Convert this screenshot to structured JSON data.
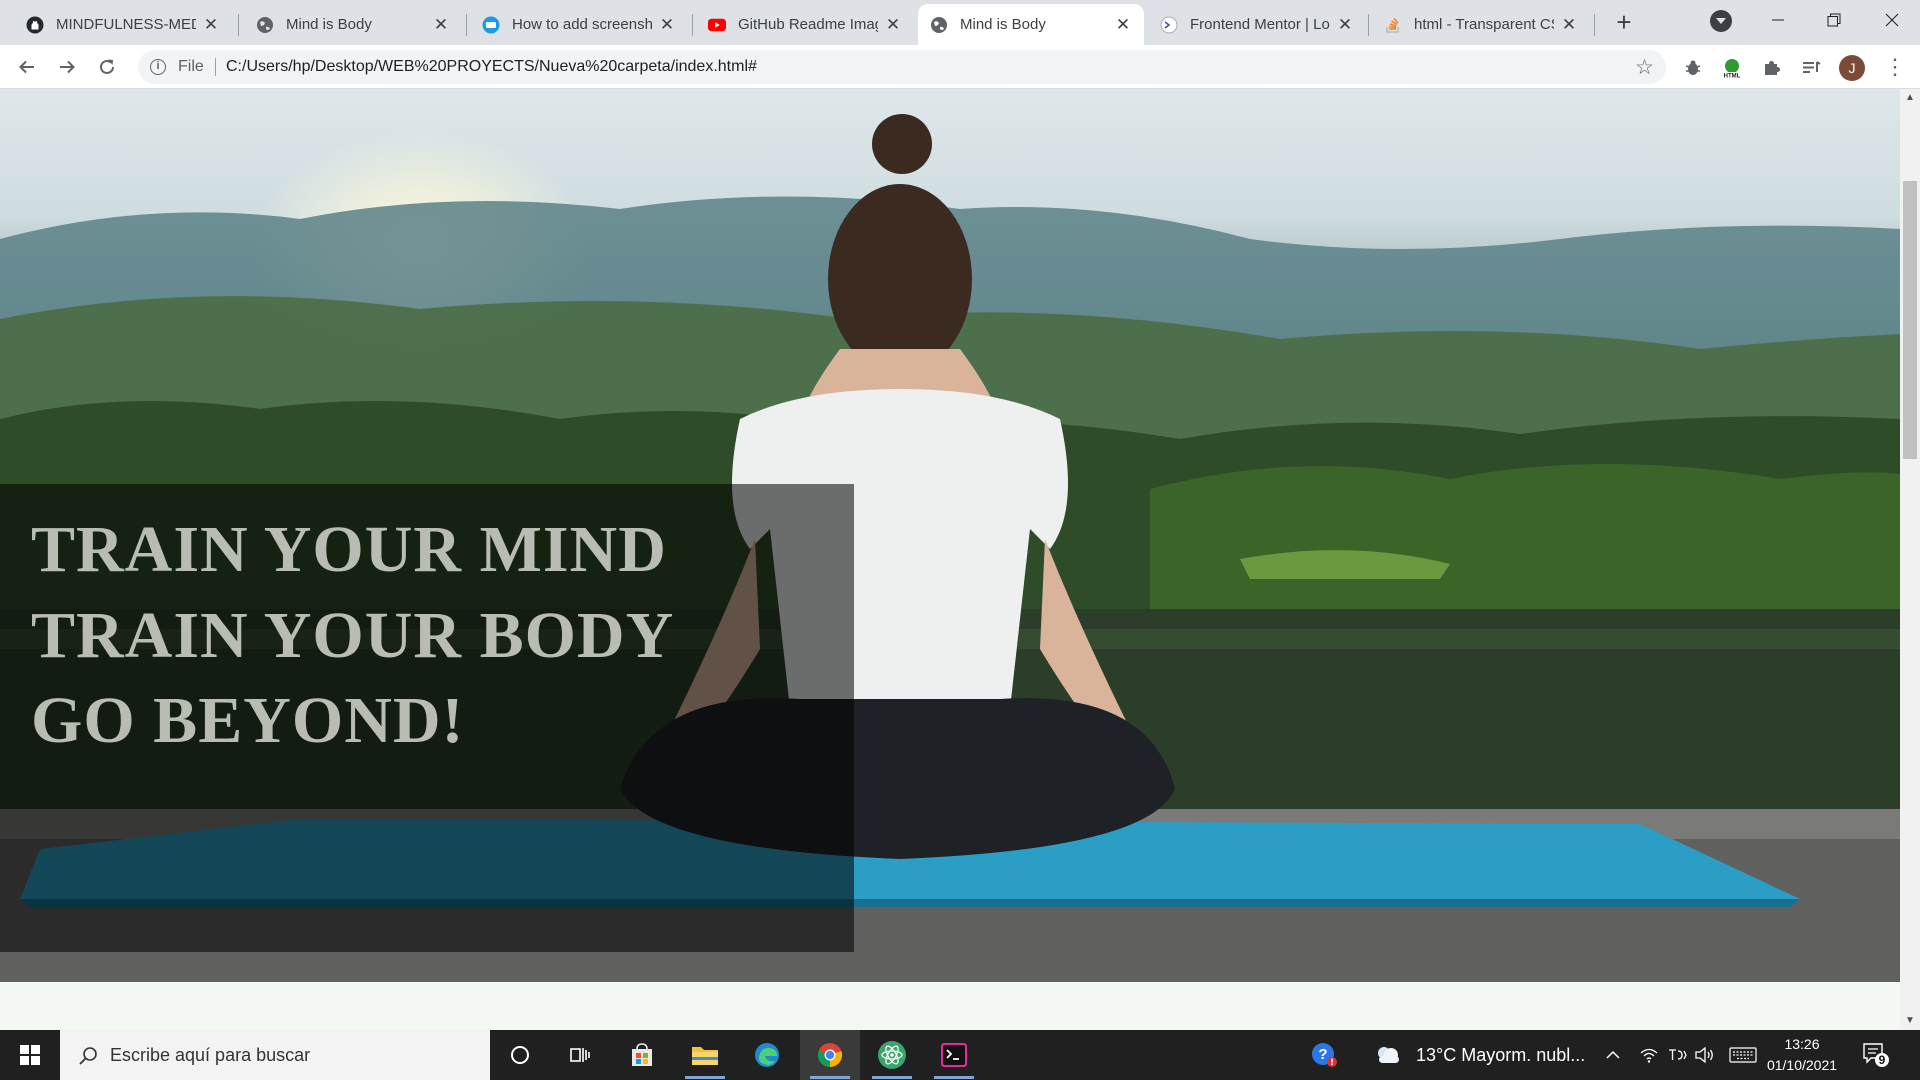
{
  "browser": {
    "tabs": [
      {
        "title": "MINDFULNESS-MEDITATION",
        "icon": "github-icon",
        "active": false
      },
      {
        "title": "Mind is Body",
        "icon": "globe-icon",
        "active": false
      },
      {
        "title": "How to add screenshot",
        "icon": "tutorial-site-icon",
        "active": false
      },
      {
        "title": "GitHub Readme Images",
        "icon": "youtube-icon",
        "active": false
      },
      {
        "title": "Mind is Body",
        "icon": "globe-icon",
        "active": true
      },
      {
        "title": "Frontend Mentor | Login",
        "icon": "frontend-mentor-icon",
        "active": false
      },
      {
        "title": "html - Transparent CSS",
        "icon": "stackoverflow-icon",
        "active": false
      }
    ],
    "tab_close_glyph": "✕",
    "new_tab_glyph": "+",
    "address": {
      "scheme_label": "File",
      "url": "C:/Users/hp/Desktop/WEB%20PROYECTS/Nueva%20carpeta/index.html#"
    },
    "profile_initial": "J"
  },
  "page": {
    "hero": {
      "lines": [
        "TRAIN YOUR MIND",
        "TRAIN YOUR BODY",
        "GO BEYOND!"
      ]
    }
  },
  "taskbar": {
    "search_placeholder": "Escribe aquí para buscar",
    "weather": "13°C  Mayorm. nubl...",
    "time": "13:26",
    "date": "01/10/2021",
    "notification_count": "9"
  },
  "colors": {
    "slogan_text": "#b8bcb2",
    "overlay": "rgba(0,0,0,0.55)",
    "tabstrip_bg": "#dee1e6",
    "taskbar_bg": "#202020"
  }
}
